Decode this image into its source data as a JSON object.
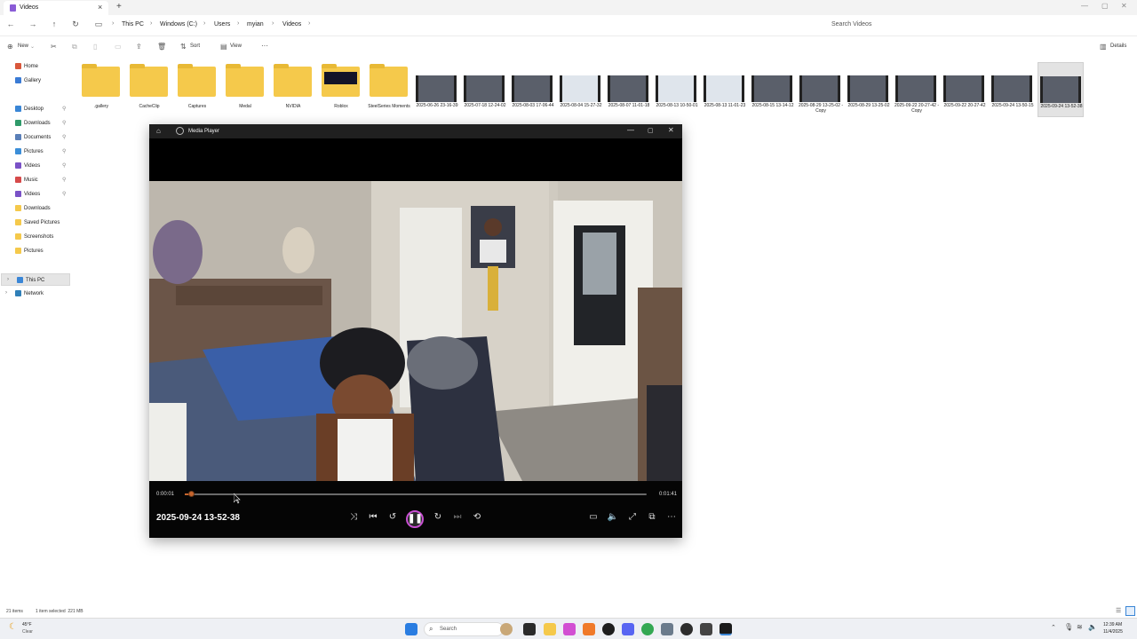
{
  "window": {
    "tab_title": "Videos",
    "new_tab": "+",
    "controls": {
      "minimize": "—",
      "maximize": "▢",
      "close": "✕"
    }
  },
  "address": {
    "breadcrumbs": [
      "This PC",
      "Windows (C:)",
      "Users",
      "myian",
      "Videos"
    ],
    "search_placeholder": "Search Videos"
  },
  "commands": {
    "new": "New",
    "sort": "Sort",
    "view": "View",
    "more": "···",
    "details": "Details"
  },
  "sidebar": {
    "top": [
      {
        "label": "Home",
        "color": "#d9583b"
      },
      {
        "label": "Gallery",
        "color": "#3a7bd5"
      }
    ],
    "quick": [
      {
        "label": "Desktop",
        "color": "#3a86d6",
        "pinned": true
      },
      {
        "label": "Downloads",
        "color": "#2f9a6a",
        "pinned": true
      },
      {
        "label": "Documents",
        "color": "#5a7fb8",
        "pinned": true
      },
      {
        "label": "Pictures",
        "color": "#3b8ed8",
        "pinned": true
      },
      {
        "label": "Videos",
        "color": "#7a52c7",
        "pinned": true
      },
      {
        "label": "Music",
        "color": "#d64a4a",
        "pinned": true
      },
      {
        "label": "Videos",
        "color": "#7a52c7",
        "pinned": true
      },
      {
        "label": "Downloads",
        "color": "#f5c94b",
        "pinned": false
      },
      {
        "label": "Saved Pictures",
        "color": "#f5c94b",
        "pinned": false
      },
      {
        "label": "Screenshots",
        "color": "#f5c94b",
        "pinned": false
      },
      {
        "label": "Pictures",
        "color": "#f5c94b",
        "pinned": false
      }
    ],
    "this_pc": "This PC",
    "network": "Network",
    "pin_glyph": "📌"
  },
  "files": [
    {
      "name": ".gallery",
      "kind": "folder"
    },
    {
      "name": "CacheClip",
      "kind": "folder"
    },
    {
      "name": "Captures",
      "kind": "folder"
    },
    {
      "name": "Medal",
      "kind": "folder"
    },
    {
      "name": "NVIDIA",
      "kind": "folder"
    },
    {
      "name": "Roblox",
      "kind": "folder-dark"
    },
    {
      "name": "SteelSeries Moments",
      "kind": "folder"
    },
    {
      "name": "2025-06-26 23-16-39",
      "kind": "video"
    },
    {
      "name": "2025-07-18 12-24-02",
      "kind": "video"
    },
    {
      "name": "2025-08-03 17-06-44",
      "kind": "video"
    },
    {
      "name": "2025-08-04 15-27-32",
      "kind": "video-light"
    },
    {
      "name": "2025-08-07 11-01-18",
      "kind": "video"
    },
    {
      "name": "2025-08-13 10-50-01",
      "kind": "video-light"
    },
    {
      "name": "2025-08-13 11-01-23",
      "kind": "video-light"
    },
    {
      "name": "2025-08-15 13-14-12",
      "kind": "video"
    },
    {
      "name": "2025-08-29 13-25-02 - Copy",
      "kind": "video"
    },
    {
      "name": "2025-08-29 13-25-02",
      "kind": "video"
    },
    {
      "name": "2025-09-22 20-27-42 - Copy",
      "kind": "video"
    },
    {
      "name": "2025-09-22 20-27-42",
      "kind": "video"
    },
    {
      "name": "2025-09-24 13-50-15",
      "kind": "video"
    },
    {
      "name": "2025-09-24 13-52-38",
      "kind": "video",
      "selected": true
    }
  ],
  "player": {
    "app_name": "Media Player",
    "current_time": "0:00:01",
    "total_time": "0:01:41",
    "progress": 0.01,
    "media_title": "2025-09-24 13-52-38",
    "accent": "#c7652e",
    "play_state_glyph": "❚❚"
  },
  "status": {
    "items": "21 items",
    "selection": "1 item selected  221 MB"
  },
  "taskbar": {
    "weather_temp": "45°F",
    "weather_desc": "Clear",
    "search": "Search",
    "time": "12:39 AM",
    "date": "11/4/2025"
  }
}
